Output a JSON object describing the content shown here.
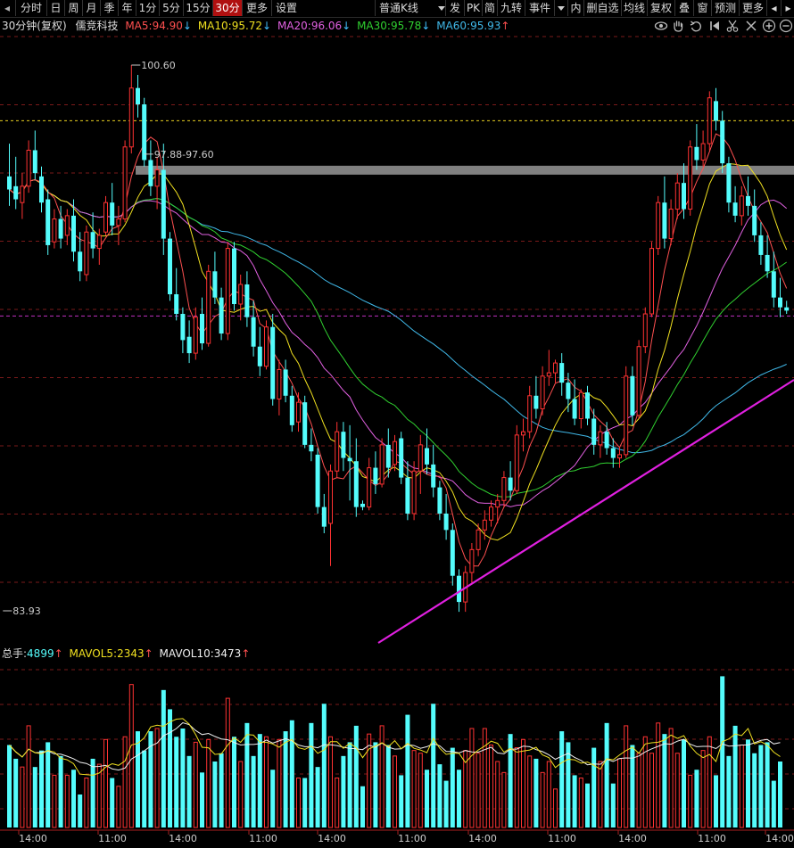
{
  "toolbar": {
    "period_tabs": [
      "分时",
      "日",
      "周",
      "月",
      "季",
      "年",
      "1分",
      "5分",
      "15分",
      "30分",
      "更多",
      "设置"
    ],
    "active_tab": "30分",
    "chart_mode": "普通K线",
    "right_buttons": [
      "发",
      "PK",
      "简",
      "九转",
      "事件",
      "内",
      "删自选",
      "均线",
      "复权",
      "叠",
      "窗",
      "预测",
      "更多"
    ]
  },
  "info": {
    "period_label": "30分钟(复权)",
    "stock_name": "儒竞科技",
    "ma": [
      {
        "label": "MA5:",
        "value": "94.90",
        "arrow": "↓",
        "color": "#ff5050"
      },
      {
        "label": "MA10:",
        "value": "95.72",
        "arrow": "↓",
        "color": "#f0e020"
      },
      {
        "label": "MA20:",
        "value": "96.06",
        "arrow": "↓",
        "color": "#e060e0"
      },
      {
        "label": "MA30:",
        "value": "95.78",
        "arrow": "↓",
        "color": "#30d030"
      },
      {
        "label": "MA60:",
        "value": "95.93",
        "arrow": "↑",
        "color": "#40b8e8"
      }
    ]
  },
  "annotations": {
    "high": "100.60",
    "low": "83.93",
    "zone": "97.88-97.60"
  },
  "volume_info": {
    "label": "总手:",
    "value": "4899",
    "arrow": "↑",
    "mavol5_label": "MAVOL5:",
    "mavol5_value": "2343",
    "mavol5_arrow": "↑",
    "mavol10_label": "MAVOL10:",
    "mavol10_value": "3473",
    "mavol10_arrow": "↑"
  },
  "time_axis": [
    "14:00",
    "11:00",
    "14:00",
    "11:00",
    "14:00",
    "11:00",
    "14:00",
    "11:00",
    "14:00",
    "11:00",
    "14:00"
  ],
  "colors": {
    "up": "#ff3232",
    "down": "#54fcfc",
    "background": "#000000",
    "grid": "#7a1a1a",
    "trendline": "#e020e0"
  },
  "chart_data": {
    "type": "candlestick",
    "price_points": {
      "high": 100.6,
      "low": 83.93,
      "resistance_zone": [
        97.6,
        97.88
      ]
    },
    "ma_last": {
      "MA5": 94.9,
      "MA10": 95.72,
      "MA20": 96.06,
      "MA30": 95.78,
      "MA60": 95.93
    },
    "volume_last": {
      "total": 4899,
      "MAVOL5": 2343,
      "MAVOL10": 3473
    },
    "ohlc": [
      [
        97.2,
        98.2,
        96.3,
        96.8
      ],
      [
        96.9,
        97.8,
        96.2,
        96.5
      ],
      [
        96.4,
        97.3,
        95.9,
        96.9
      ],
      [
        96.9,
        98.3,
        96.7,
        98.0
      ],
      [
        98.0,
        98.6,
        97.1,
        97.3
      ],
      [
        97.2,
        97.5,
        96.1,
        96.4
      ],
      [
        96.5,
        96.8,
        94.8,
        95.1
      ],
      [
        95.2,
        96.2,
        95.0,
        95.9
      ],
      [
        95.9,
        96.3,
        95.0,
        95.3
      ],
      [
        95.4,
        96.2,
        95.1,
        96.0
      ],
      [
        96.0,
        96.5,
        94.6,
        94.9
      ],
      [
        94.9,
        95.5,
        94.0,
        94.3
      ],
      [
        94.2,
        95.7,
        94.0,
        95.5
      ],
      [
        95.5,
        96.1,
        94.7,
        95.0
      ],
      [
        95.0,
        95.6,
        94.5,
        95.4
      ],
      [
        95.5,
        96.6,
        95.4,
        96.4
      ],
      [
        96.4,
        97.0,
        95.4,
        95.7
      ],
      [
        95.7,
        96.3,
        95.1,
        95.9
      ],
      [
        95.9,
        98.3,
        95.8,
        98.1
      ],
      [
        98.1,
        100.6,
        97.9,
        99.9
      ],
      [
        99.9,
        100.3,
        99.0,
        99.4
      ],
      [
        99.4,
        99.6,
        97.5,
        97.7
      ],
      [
        97.7,
        98.3,
        96.6,
        96.9
      ],
      [
        96.9,
        97.8,
        96.2,
        97.4
      ],
      [
        97.4,
        98.2,
        94.8,
        95.3
      ],
      [
        95.3,
        95.5,
        93.4,
        93.6
      ],
      [
        93.6,
        94.4,
        92.8,
        93.0
      ],
      [
        93.0,
        93.2,
        91.8,
        92.2
      ],
      [
        92.3,
        92.8,
        91.5,
        91.8
      ],
      [
        91.8,
        93.2,
        91.6,
        92.9
      ],
      [
        93.0,
        93.5,
        91.9,
        92.1
      ],
      [
        92.1,
        94.5,
        92.0,
        94.3
      ],
      [
        94.3,
        94.9,
        93.3,
        93.5
      ],
      [
        93.5,
        93.8,
        92.2,
        92.4
      ],
      [
        92.4,
        95.2,
        92.2,
        95.0
      ],
      [
        95.0,
        95.2,
        93.1,
        93.3
      ],
      [
        93.3,
        94.2,
        92.8,
        93.9
      ],
      [
        93.9,
        94.3,
        92.6,
        92.9
      ],
      [
        92.9,
        93.4,
        91.7,
        92.0
      ],
      [
        92.0,
        92.6,
        91.1,
        91.4
      ],
      [
        91.4,
        92.8,
        91.3,
        92.6
      ],
      [
        92.6,
        93.0,
        90.2,
        90.4
      ],
      [
        90.4,
        91.6,
        89.9,
        91.3
      ],
      [
        91.3,
        91.6,
        90.3,
        90.5
      ],
      [
        90.5,
        90.8,
        89.4,
        89.6
      ],
      [
        89.7,
        90.6,
        89.4,
        90.3
      ],
      [
        90.3,
        90.5,
        88.9,
        89.0
      ],
      [
        89.0,
        89.5,
        88.5,
        88.8
      ],
      [
        88.7,
        88.9,
        86.9,
        87.1
      ],
      [
        87.1,
        87.5,
        86.3,
        86.5
      ],
      [
        86.6,
        88.4,
        85.3,
        88.2
      ],
      [
        88.2,
        89.7,
        88.0,
        89.4
      ],
      [
        89.4,
        89.7,
        88.2,
        88.6
      ],
      [
        88.6,
        89.6,
        87.3,
        88.5
      ],
      [
        88.5,
        89.2,
        86.8,
        87.1
      ],
      [
        87.2,
        87.3,
        87.0,
        87.1
      ],
      [
        87.1,
        88.6,
        87.0,
        88.3
      ],
      [
        88.3,
        88.8,
        87.5,
        87.8
      ],
      [
        87.8,
        89.2,
        87.7,
        89.0
      ],
      [
        89.0,
        89.5,
        88.0,
        88.3
      ],
      [
        88.4,
        89.3,
        88.2,
        89.1
      ],
      [
        89.2,
        89.4,
        87.8,
        88.0
      ],
      [
        88.0,
        88.5,
        86.7,
        86.9
      ],
      [
        86.9,
        88.5,
        86.7,
        88.2
      ],
      [
        88.2,
        89.3,
        87.5,
        89.0
      ],
      [
        88.9,
        89.5,
        88.1,
        88.4
      ],
      [
        88.4,
        89.0,
        87.4,
        87.7
      ],
      [
        87.7,
        87.9,
        86.7,
        86.9
      ],
      [
        86.9,
        87.5,
        86.1,
        86.4
      ],
      [
        86.4,
        86.6,
        84.7,
        85.0
      ],
      [
        85.0,
        85.2,
        83.9,
        84.2
      ],
      [
        84.2,
        85.3,
        83.9,
        85.1
      ],
      [
        85.1,
        86.0,
        84.8,
        85.8
      ],
      [
        85.8,
        86.6,
        85.6,
        86.4
      ],
      [
        86.4,
        87.0,
        86.1,
        86.7
      ],
      [
        86.7,
        87.3,
        86.5,
        87.1
      ],
      [
        87.1,
        87.5,
        86.6,
        87.3
      ],
      [
        87.3,
        88.2,
        87.1,
        88.0
      ],
      [
        88.0,
        88.5,
        87.3,
        87.6
      ],
      [
        87.6,
        89.6,
        87.5,
        89.3
      ],
      [
        89.3,
        89.8,
        88.8,
        89.4
      ],
      [
        89.4,
        90.8,
        89.2,
        90.5
      ],
      [
        90.5,
        91.1,
        89.8,
        90.1
      ],
      [
        90.1,
        91.4,
        89.9,
        91.1
      ],
      [
        91.1,
        91.9,
        90.8,
        91.2
      ],
      [
        91.2,
        91.6,
        90.9,
        91.5
      ],
      [
        91.5,
        91.8,
        90.5,
        90.9
      ],
      [
        90.9,
        91.2,
        90.0,
        90.4
      ],
      [
        90.4,
        91.0,
        89.6,
        89.8
      ],
      [
        89.8,
        90.7,
        89.5,
        90.6
      ],
      [
        90.6,
        90.8,
        89.6,
        89.8
      ],
      [
        89.8,
        90.1,
        88.7,
        89.0
      ],
      [
        89.0,
        89.6,
        88.6,
        89.4
      ],
      [
        89.4,
        89.7,
        88.7,
        88.9
      ],
      [
        88.9,
        89.2,
        88.3,
        88.6
      ],
      [
        88.6,
        88.9,
        88.3,
        88.7
      ],
      [
        88.7,
        91.4,
        88.6,
        91.1
      ],
      [
        91.1,
        91.4,
        89.6,
        89.9
      ],
      [
        89.9,
        92.2,
        89.8,
        92.0
      ],
      [
        92.0,
        93.2,
        91.8,
        93.0
      ],
      [
        93.0,
        95.2,
        92.9,
        95.0
      ],
      [
        95.0,
        96.6,
        94.8,
        96.4
      ],
      [
        96.4,
        97.2,
        95.0,
        95.3
      ],
      [
        95.3,
        96.5,
        95.1,
        96.2
      ],
      [
        96.2,
        97.3,
        95.9,
        97.0
      ],
      [
        97.0,
        97.6,
        95.9,
        96.2
      ],
      [
        96.2,
        98.3,
        96.0,
        98.1
      ],
      [
        98.1,
        98.8,
        97.4,
        97.7
      ],
      [
        97.7,
        98.6,
        97.5,
        98.2
      ],
      [
        98.2,
        99.8,
        98.0,
        99.6
      ],
      [
        99.5,
        99.9,
        98.6,
        98.9
      ],
      [
        98.9,
        99.2,
        97.3,
        97.6
      ],
      [
        97.6,
        97.8,
        96.1,
        96.4
      ],
      [
        96.4,
        96.9,
        95.8,
        96.0
      ],
      [
        96.0,
        96.9,
        95.7,
        96.6
      ],
      [
        96.6,
        97.2,
        96.0,
        96.3
      ],
      [
        96.3,
        96.8,
        95.2,
        95.4
      ],
      [
        95.4,
        95.8,
        94.5,
        94.8
      ],
      [
        94.8,
        95.4,
        94.1,
        94.3
      ],
      [
        94.3,
        94.9,
        93.2,
        93.5
      ],
      [
        93.5,
        94.1,
        92.9,
        93.2
      ],
      [
        93.2,
        93.4,
        93.0,
        93.1
      ]
    ],
    "volume": [
      30,
      25,
      22,
      37,
      22,
      28,
      31,
      19,
      26,
      19,
      21,
      12,
      18,
      25,
      23,
      32,
      18,
      15,
      33,
      52,
      35,
      28,
      35,
      36,
      50,
      43,
      33,
      36,
      26,
      31,
      20,
      32,
      24,
      27,
      47,
      33,
      24,
      38,
      26,
      34,
      33,
      21,
      32,
      35,
      39,
      18,
      18,
      38,
      22,
      45,
      33,
      18,
      26,
      31,
      37,
      15,
      34,
      31,
      37,
      30,
      26,
      19,
      41,
      28,
      27,
      21,
      45,
      23,
      17,
      29,
      21,
      28,
      36,
      27,
      36,
      30,
      24,
      20,
      34,
      29,
      32,
      26,
      25,
      20,
      24,
      14,
      35,
      31,
      19,
      18,
      16,
      29,
      24,
      38,
      16,
      25,
      37,
      30,
      27,
      33,
      27,
      38,
      34,
      36,
      27,
      32,
      19,
      21,
      28,
      33,
      19,
      55,
      26,
      37,
      30,
      32,
      27,
      30,
      31,
      17,
      24
    ]
  }
}
